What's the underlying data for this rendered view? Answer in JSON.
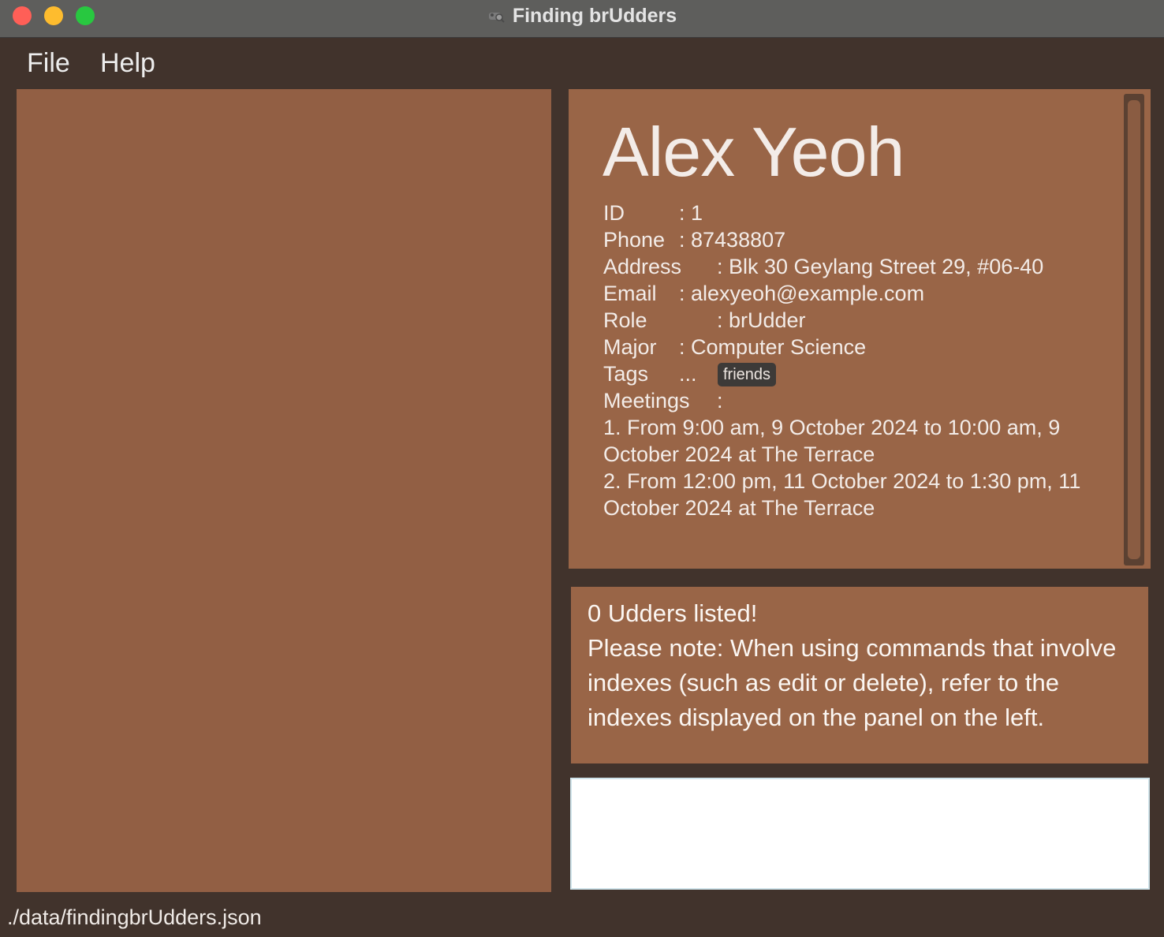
{
  "window": {
    "title": "Finding brUdders",
    "app_icon": "cow-icon"
  },
  "menu": {
    "file": "File",
    "help": "Help"
  },
  "person": {
    "name": "Alex Yeoh",
    "id_label": "ID",
    "id_value": ": 1",
    "phone_label": "Phone",
    "phone_value": ": 87438807",
    "address_label": "Address",
    "address_value": ": Blk 30 Geylang Street 29, #06-40",
    "email_label": "Email",
    "email_value": ": alexyeoh@example.com",
    "role_label": "Role",
    "role_value": ": brUdder",
    "major_label": "Major",
    "major_value": ": Computer Science",
    "tags_label": "Tags",
    "tags_sep": "...",
    "tags": [
      "friends"
    ],
    "meetings_label": "Meetings",
    "meetings_sep": ":",
    "meetings": [
      "1. From 9:00 am, 9 October 2024 to 10:00 am, 9 October 2024 at The Terrace",
      "2. From 12:00 pm, 11 October 2024 to 1:30 pm, 11 October 2024 at The Terrace"
    ]
  },
  "result": {
    "line1": "0 Udders listed!",
    "line2": "Please note: When using commands that involve indexes (such as edit or delete), refer to the indexes displayed on the panel on the left."
  },
  "command": {
    "value": ""
  },
  "status": {
    "file_path": "./data/findingbrUdders.json"
  },
  "colors": {
    "background": "#41332c",
    "panel": "#996547",
    "list_panel": "#925f44",
    "tag": "#3d3a38"
  }
}
